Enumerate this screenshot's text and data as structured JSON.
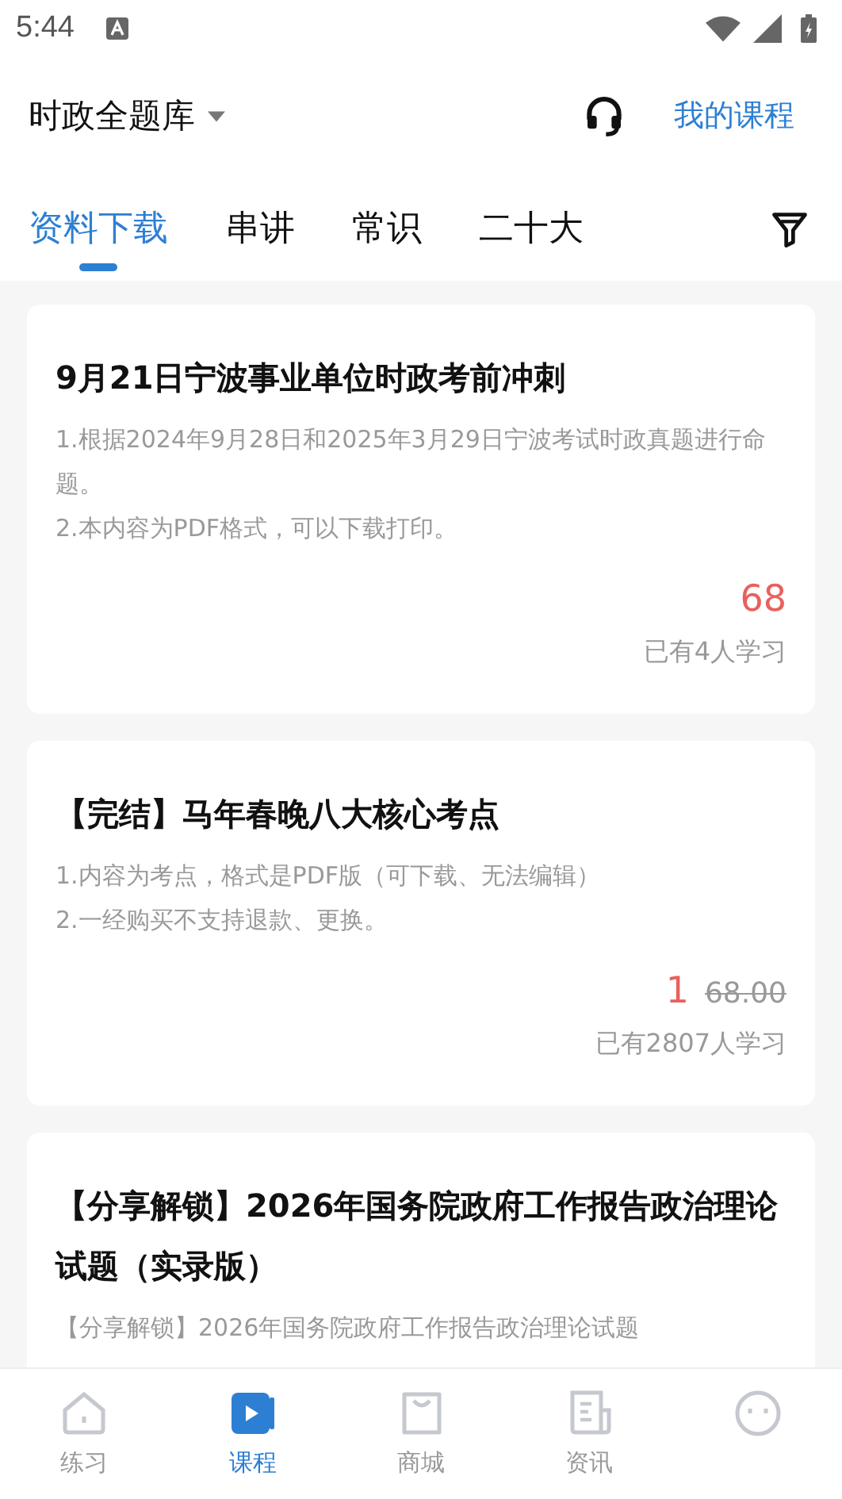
{
  "status_bar": {
    "time": "5:44"
  },
  "header": {
    "title": "时政全题库",
    "link": "我的课程"
  },
  "tabs": [
    {
      "label": "资料下载",
      "selected": true
    },
    {
      "label": "串讲",
      "selected": false
    },
    {
      "label": "常识",
      "selected": false
    },
    {
      "label": "二十大",
      "selected": false
    }
  ],
  "courses": [
    {
      "title": "9月21日宁波事业单位时政考前冲刺",
      "description": [
        "1.根据2024年9月28日和2025年3月29日宁波考试时政真题进行命题。",
        "2.本内容为PDF格式，可以下载打印。"
      ],
      "price": "68",
      "learners": "已有4人学习"
    },
    {
      "title": "【完结】马年春晚八大核心考点",
      "description": [
        "1.内容为考点，格式是PDF版（可下载、无法编辑）",
        "2.一经购买不支持退款、更换。"
      ],
      "price": "1",
      "original_price": "68.00",
      "learners": "已有2807人学习"
    },
    {
      "title": "【分享解锁】2026年国务院政府工作报告政治理论试题（实录版）",
      "description": [
        "【分享解锁】2026年国务院政府工作报告政治理论试题"
      ]
    }
  ],
  "bottom_nav": [
    {
      "kind": "home",
      "label": "练习",
      "selected": false
    },
    {
      "kind": "course",
      "label": "课程",
      "selected": true
    },
    {
      "kind": "shop",
      "label": "商城",
      "selected": false
    },
    {
      "kind": "news",
      "label": "资讯",
      "selected": false
    },
    {
      "kind": "profile",
      "selected": false
    }
  ]
}
